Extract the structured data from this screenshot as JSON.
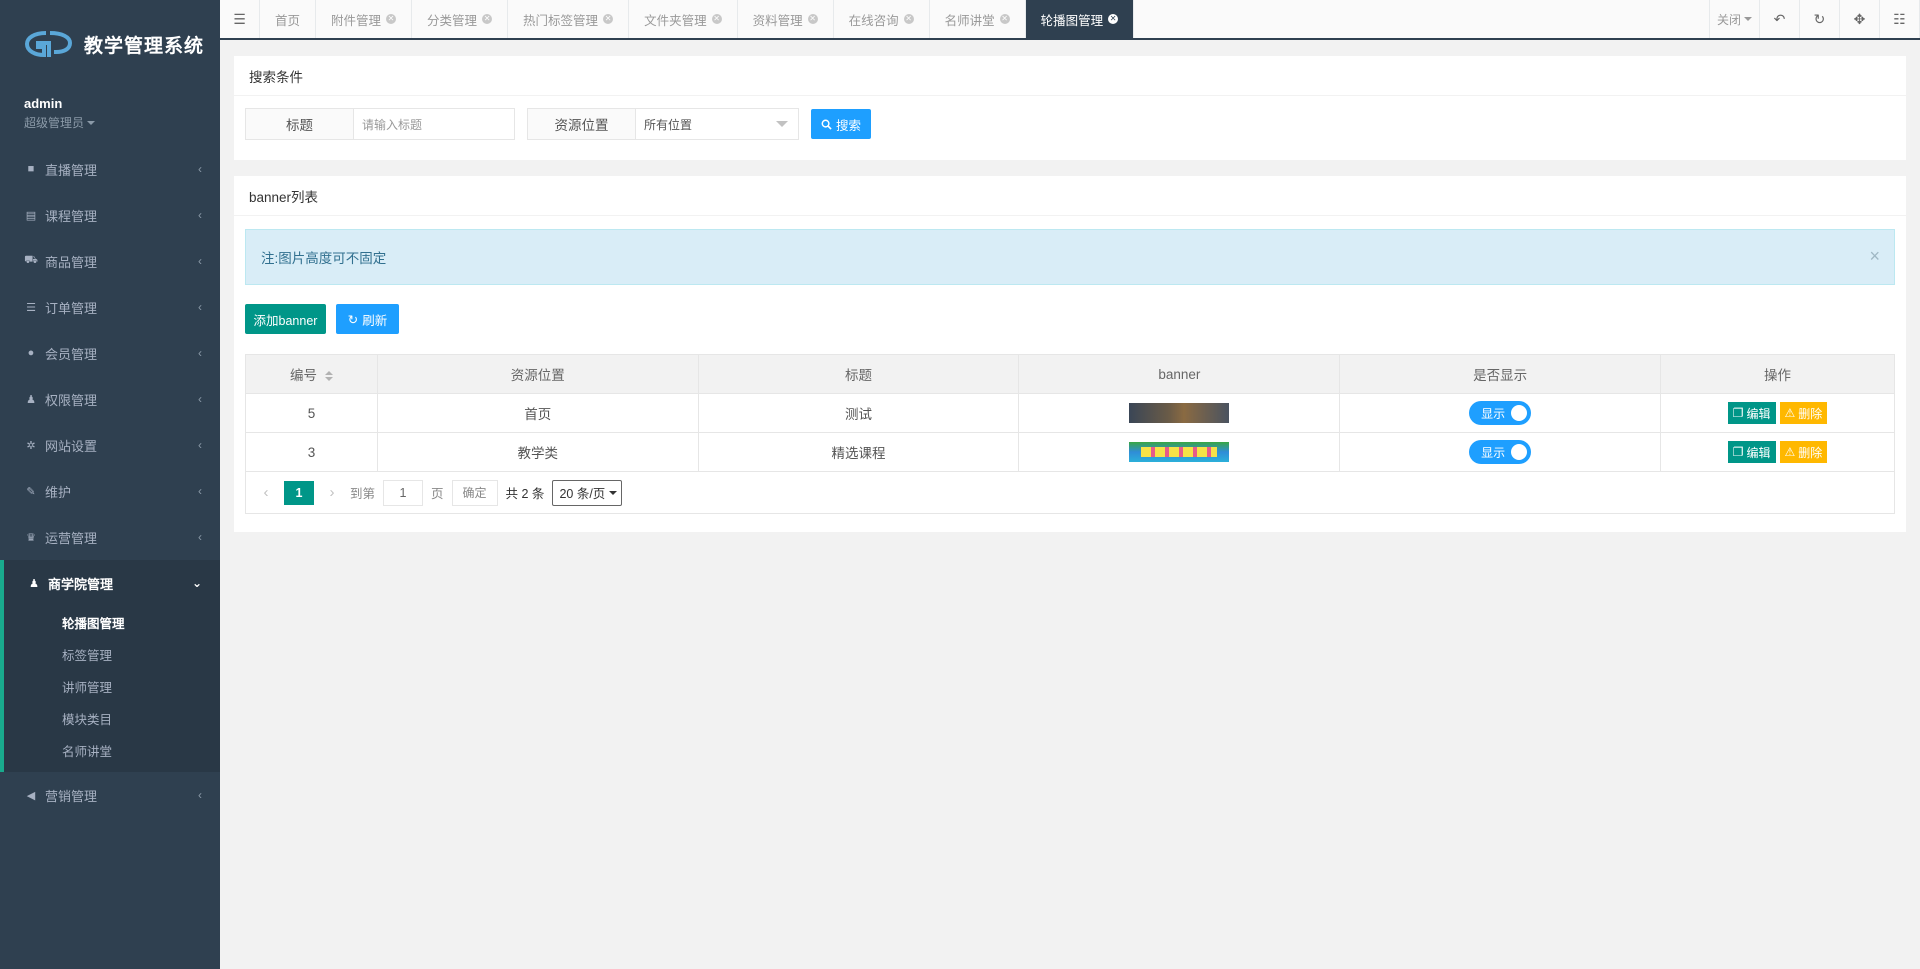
{
  "app": {
    "title": "教学管理系统"
  },
  "user": {
    "name": "admin",
    "role": "超级管理员"
  },
  "sidebar": {
    "items": [
      {
        "label": "直播管理",
        "icon": "video-icon"
      },
      {
        "label": "课程管理",
        "icon": "book-icon"
      },
      {
        "label": "商品管理",
        "icon": "cart-icon"
      },
      {
        "label": "订单管理",
        "icon": "list-icon"
      },
      {
        "label": "会员管理",
        "icon": "user-icon"
      },
      {
        "label": "权限管理",
        "icon": "users-icon"
      },
      {
        "label": "网站设置",
        "icon": "gear-icon"
      },
      {
        "label": "维护",
        "icon": "wand-icon"
      },
      {
        "label": "运营管理",
        "icon": "trophy-icon"
      }
    ],
    "active_group": {
      "label": "商学院管理",
      "icon": "users-icon",
      "children": [
        "轮播图管理",
        "标签管理",
        "讲师管理",
        "模块类目",
        "名师讲堂"
      ],
      "current": "轮播图管理"
    },
    "after": [
      {
        "label": "营销管理",
        "icon": "bullhorn-icon"
      }
    ]
  },
  "tabs": [
    {
      "label": "首页",
      "closable": false
    },
    {
      "label": "附件管理",
      "closable": true
    },
    {
      "label": "分类管理",
      "closable": true
    },
    {
      "label": "热门标签管理",
      "closable": true
    },
    {
      "label": "文件夹管理",
      "closable": true
    },
    {
      "label": "资料管理",
      "closable": true
    },
    {
      "label": "在线咨询",
      "closable": true
    },
    {
      "label": "名师讲堂",
      "closable": true
    },
    {
      "label": "轮播图管理",
      "closable": true,
      "active": true
    }
  ],
  "toolbar": {
    "close_label": "关闭"
  },
  "search": {
    "panel_title": "搜索条件",
    "title_label": "标题",
    "title_placeholder": "请输入标题",
    "position_label": "资源位置",
    "position_value": "所有位置",
    "search_button": "搜索"
  },
  "list": {
    "panel_title": "banner列表",
    "notice": "注:图片高度可不固定",
    "add_button": "添加banner",
    "refresh_button": "刷新",
    "columns": [
      "编号",
      "资源位置",
      "标题",
      "banner",
      "是否显示",
      "操作"
    ],
    "rows": [
      {
        "id": "5",
        "position": "首页",
        "title": "测试",
        "show": "显示"
      },
      {
        "id": "3",
        "position": "教学类",
        "title": "精选课程",
        "show": "显示"
      }
    ],
    "edit_label": "编辑",
    "delete_label": "删除"
  },
  "pager": {
    "current": "1",
    "goto_label": "到第",
    "page_value": "1",
    "page_unit": "页",
    "confirm": "确定",
    "total": "共 2 条",
    "page_size": "20 条/页"
  },
  "colors": {
    "sidebar": "#2f4050",
    "primary": "#009688",
    "blue": "#1e9fff",
    "warn": "#ffb800"
  }
}
